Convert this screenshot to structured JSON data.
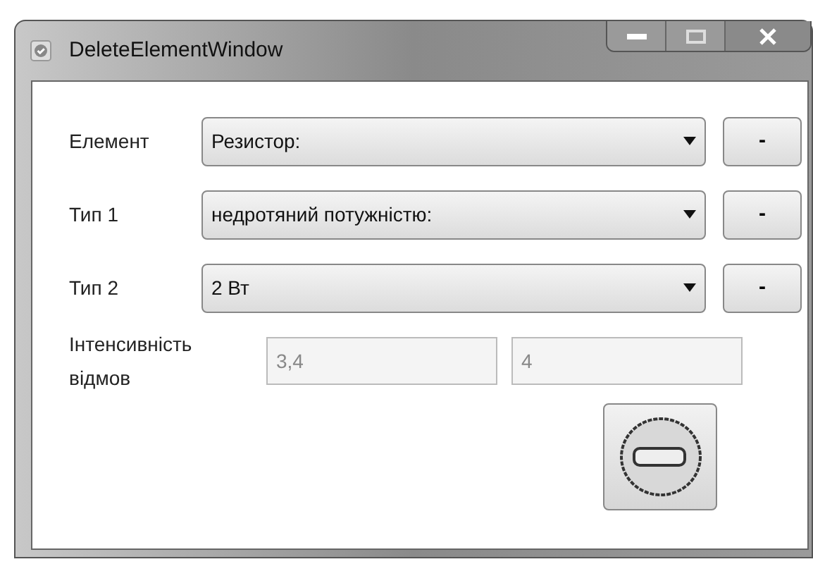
{
  "window": {
    "title": "DeleteElementWindow"
  },
  "rows": [
    {
      "label": "Елемент",
      "value": "Резистор:",
      "button": "-"
    },
    {
      "label": "Тип 1",
      "value": "недротяний потужністю:",
      "button": "-"
    },
    {
      "label": "Тип 2",
      "value": "2 Вт",
      "button": "-"
    }
  ],
  "intensity": {
    "label": "Інтенсивність відмов",
    "fields": [
      {
        "value": "3,4",
        "disabled": true
      },
      {
        "value": "4",
        "disabled": true
      }
    ]
  }
}
